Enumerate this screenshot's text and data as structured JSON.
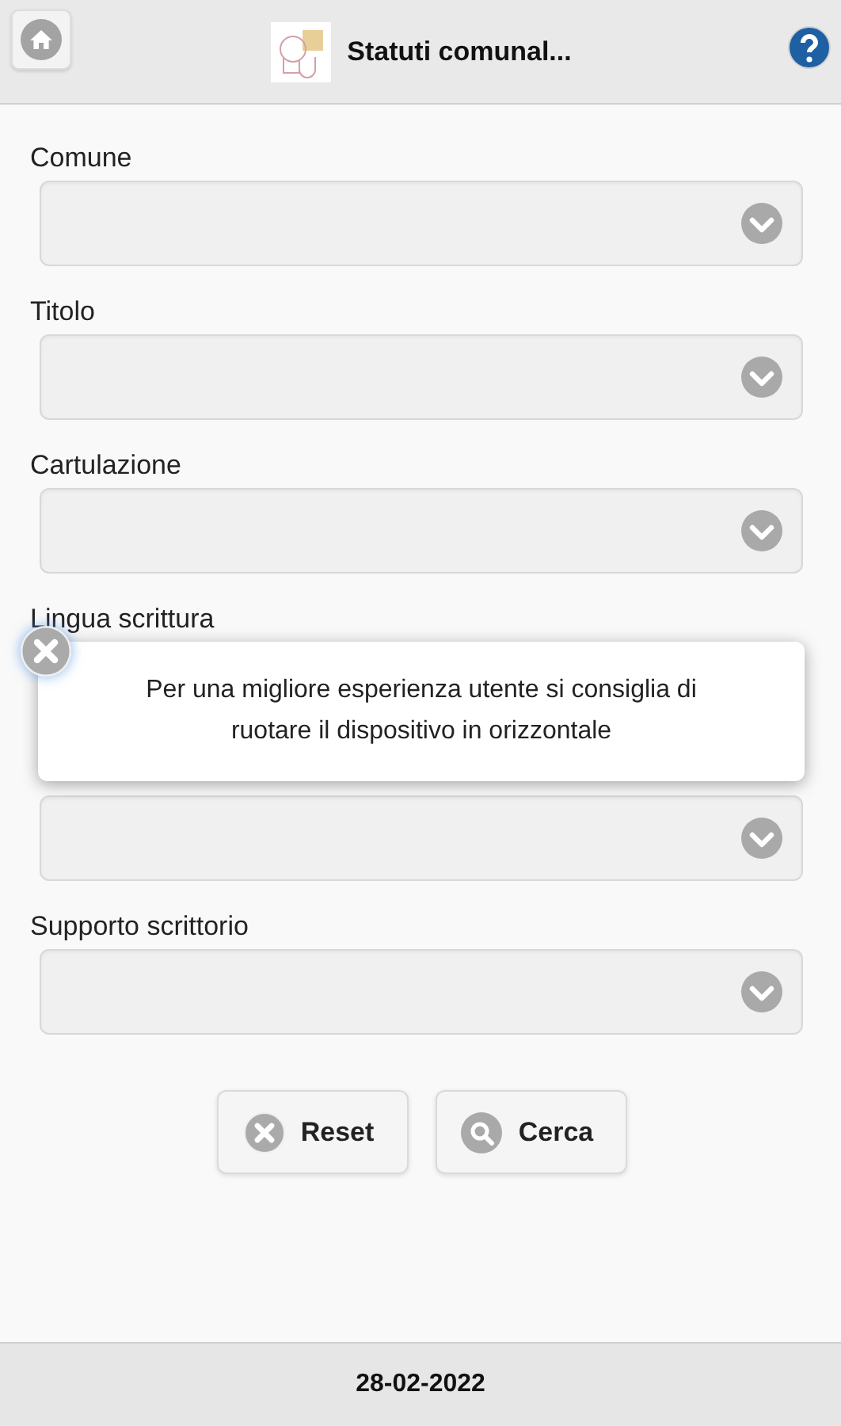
{
  "header": {
    "title": "Statuti comunal..."
  },
  "fields": [
    {
      "kind": "labeled",
      "label": "Comune"
    },
    {
      "kind": "labeled",
      "label": "Titolo"
    },
    {
      "kind": "labeled",
      "label": "Cartulazione"
    },
    {
      "kind": "label_only",
      "label": "Lingua scrittura"
    },
    {
      "kind": "covered"
    },
    {
      "kind": "labeled",
      "label": "Supporto scrittorio"
    }
  ],
  "buttons": [
    {
      "label": "Reset",
      "kind": "reset"
    },
    {
      "label": "Cerca",
      "kind": "search"
    }
  ],
  "toast": {
    "message": "Per una migliore esperienza utente si consiglia di ruotare il dispositivo in orizzontale"
  },
  "footer": {
    "date": "28-02-2022"
  }
}
